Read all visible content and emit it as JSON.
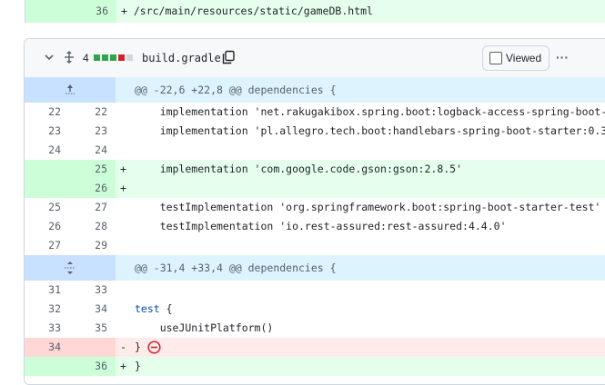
{
  "top_line": {
    "num": "36",
    "text": "+ /src/main/resources/static/gameDB.html"
  },
  "file_header": {
    "change_count": "4",
    "filename": "build.gradle",
    "viewed_label": "Viewed",
    "more_label": "···",
    "stats_colors": [
      "#2da44e",
      "#2da44e",
      "#2da44e",
      "#cf222e",
      "#d0d7de"
    ]
  },
  "hunk1": {
    "text": "@@ -22,6 +22,8 @@ dependencies {"
  },
  "hunk2": {
    "text": "@@ -31,4 +33,4 @@ dependencies {"
  },
  "lines": [
    {
      "type": "ctx",
      "old": "22",
      "new": "22",
      "sign": "",
      "text": "    implementation 'net.rakugakibox.spring.boot:logback-access-spring-boot-s"
    },
    {
      "type": "ctx",
      "old": "23",
      "new": "23",
      "sign": "",
      "text": "    implementation 'pl.allegro.tech.boot:handlebars-spring-boot-starter:0.3"
    },
    {
      "type": "ctx",
      "old": "24",
      "new": "24",
      "sign": "",
      "text": ""
    },
    {
      "type": "add",
      "old": "",
      "new": "25",
      "sign": "+",
      "text": "    implementation 'com.google.code.gson:gson:2.8.5'"
    },
    {
      "type": "add",
      "old": "",
      "new": "26",
      "sign": "+",
      "text": ""
    },
    {
      "type": "ctx",
      "old": "25",
      "new": "27",
      "sign": "",
      "text": "    testImplementation 'org.springframework.boot:spring-boot-starter-test'"
    },
    {
      "type": "ctx",
      "old": "26",
      "new": "28",
      "sign": "",
      "text": "    testImplementation 'io.rest-assured:rest-assured:4.4.0'"
    },
    {
      "type": "ctx",
      "old": "27",
      "new": "29",
      "sign": "",
      "text": ""
    },
    {
      "type": "ctx",
      "old": "31",
      "new": "33",
      "sign": "",
      "text": ""
    },
    {
      "type": "ctx",
      "old": "32",
      "new": "34",
      "sign": "",
      "text_kw": "test",
      "text": " {"
    },
    {
      "type": "ctx",
      "old": "33",
      "new": "35",
      "sign": "",
      "text": "    useJUnitPlatform()"
    },
    {
      "type": "del",
      "old": "34",
      "new": "",
      "sign": "-",
      "text": "}"
    },
    {
      "type": "add",
      "old": "",
      "new": "36",
      "sign": "+",
      "text": "}"
    }
  ]
}
